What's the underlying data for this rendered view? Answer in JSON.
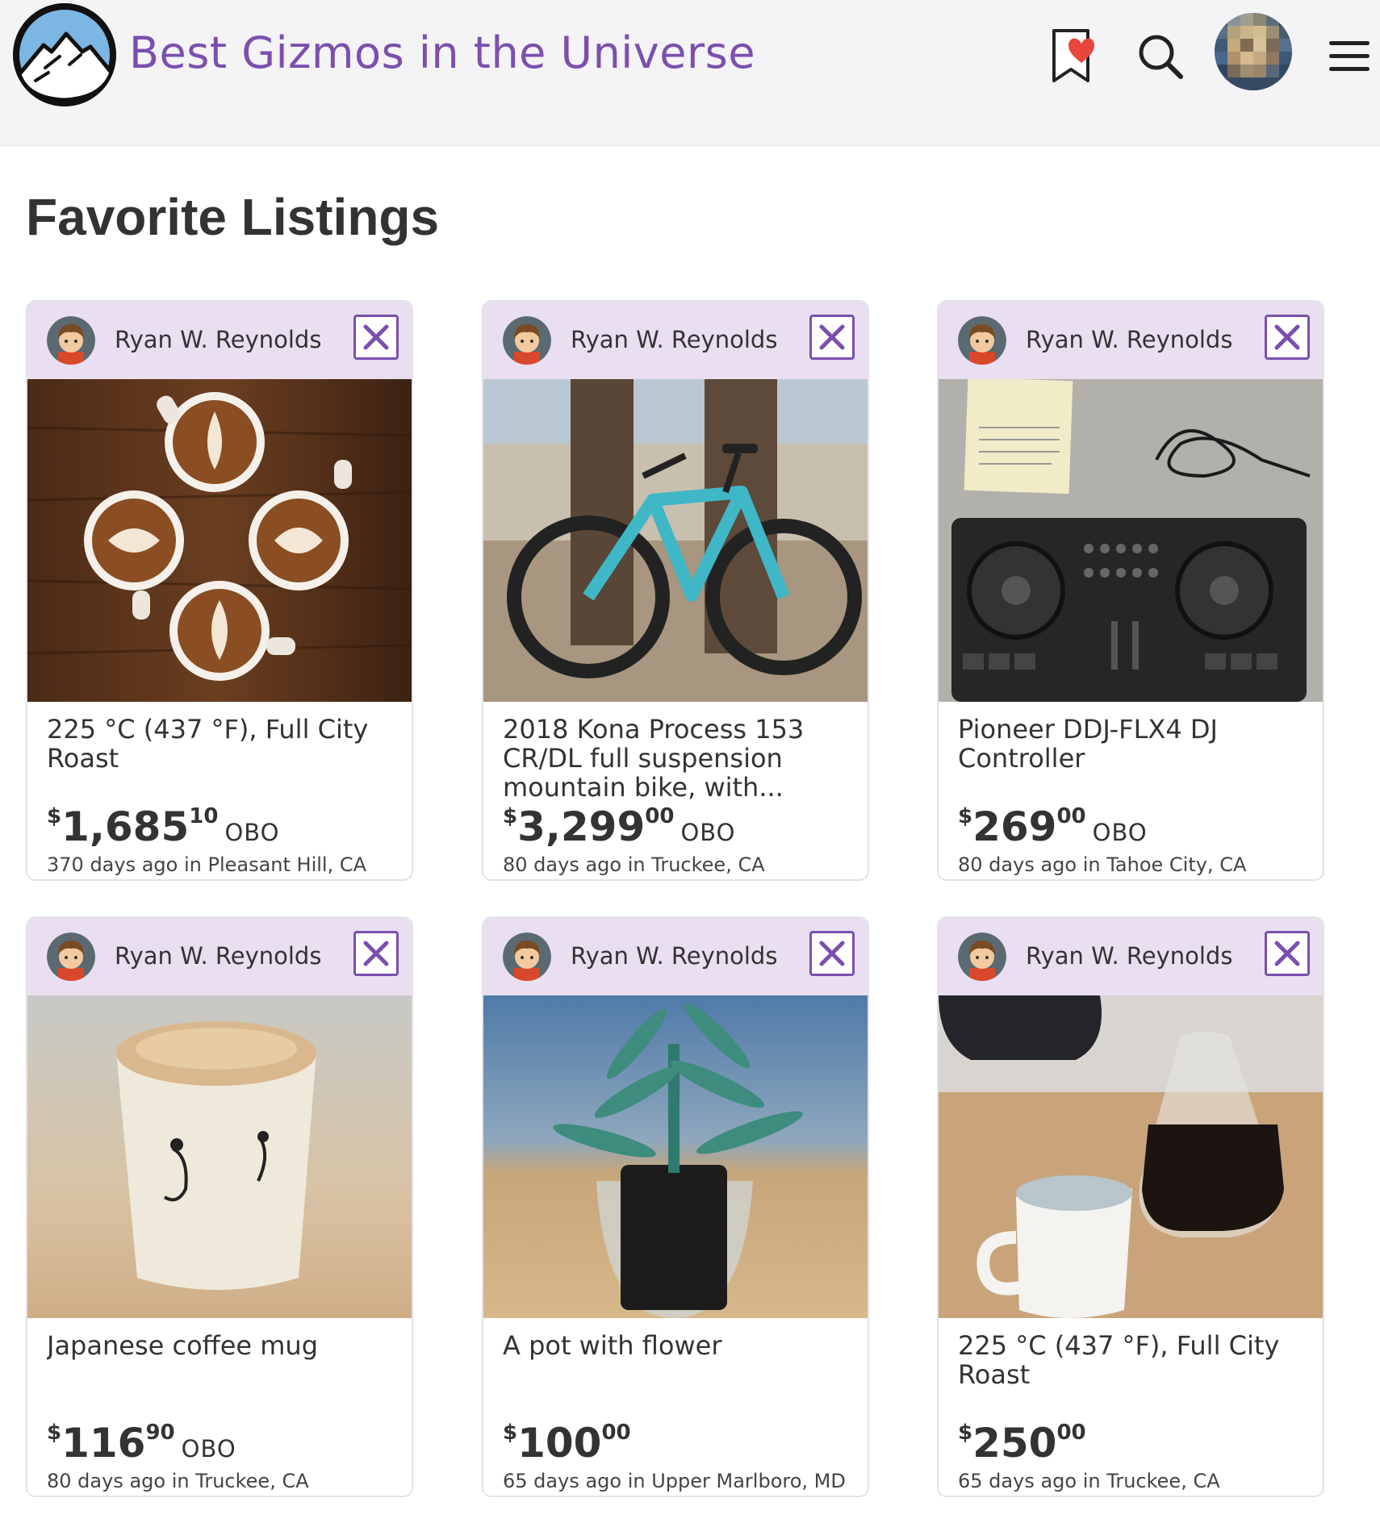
{
  "header": {
    "site_title": "Best Gizmos in the Universe",
    "icons": [
      "mountain-logo-icon",
      "bookmark-heart-icon",
      "search-icon",
      "user-avatar",
      "hamburger-menu-icon"
    ]
  },
  "page_title": "Favorite Listings",
  "colors": {
    "brand": "#7b4fae",
    "card_header": "#e9dff1",
    "header_bg": "#f4f3f6",
    "heart": "#e8453c"
  },
  "listings": [
    {
      "seller": "Ryan W. Reynolds",
      "title": "225 °C (437 °F), Full City Roast",
      "currency": "$",
      "price_dollars": "1,685",
      "price_cents": "10",
      "obo": "OBO",
      "meta": "370 days ago in Pleasant Hill, CA",
      "image": "latte-art-cups"
    },
    {
      "seller": "Ryan W. Reynolds",
      "title": "2018 Kona Process 153 CR/DL full suspension mountain bike, with...",
      "currency": "$",
      "price_dollars": "3,299",
      "price_cents": "00",
      "obo": "OBO",
      "meta": "80 days ago in Truckee, CA",
      "image": "mountain-bike"
    },
    {
      "seller": "Ryan W. Reynolds",
      "title": "Pioneer DDJ-FLX4 DJ Controller",
      "currency": "$",
      "price_dollars": "269",
      "price_cents": "00",
      "obo": "OBO",
      "meta": "80 days ago in Tahoe City, CA",
      "image": "dj-controller"
    },
    {
      "seller": "Ryan W. Reynolds",
      "title": "Japanese coffee mug",
      "currency": "$",
      "price_dollars": "116",
      "price_cents": "90",
      "obo": "OBO",
      "meta": "80 days ago in Truckee, CA",
      "image": "coffee-mug"
    },
    {
      "seller": "Ryan W. Reynolds",
      "title": "A pot with flower",
      "currency": "$",
      "price_dollars": "100",
      "price_cents": "00",
      "obo": "",
      "meta": "65 days ago in Upper Marlboro, MD",
      "image": "potted-plant"
    },
    {
      "seller": "Ryan W. Reynolds",
      "title": "225 °C (437 °F), Full City Roast",
      "currency": "$",
      "price_dollars": "250",
      "price_cents": "00",
      "obo": "",
      "meta": "65 days ago in Truckee, CA",
      "image": "coffee-pourover"
    }
  ]
}
